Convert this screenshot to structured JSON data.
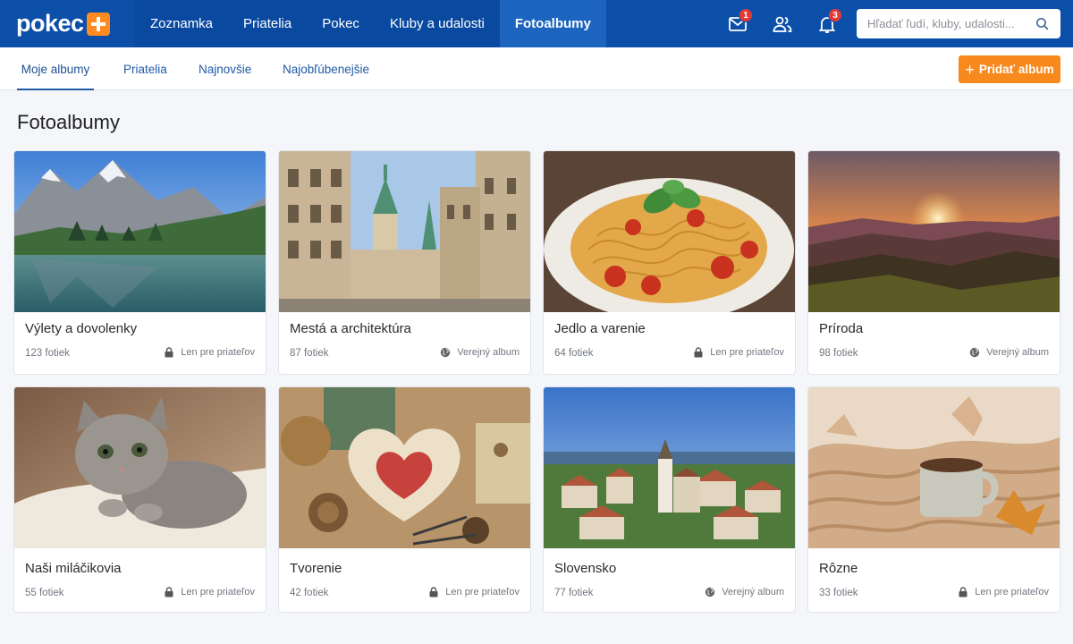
{
  "logo": {
    "text": "pokec"
  },
  "nav": {
    "items": [
      "Zoznamka",
      "Priatelia",
      "Pokec",
      "Kluby a udalosti",
      "Fotoalbumy"
    ],
    "active": "Fotoalbumy"
  },
  "top_icons": {
    "messages": {
      "icon": "mail-icon",
      "badge": "1"
    },
    "friends": {
      "icon": "people-icon"
    },
    "notifications": {
      "icon": "bell-icon",
      "badge": "3"
    }
  },
  "search": {
    "placeholder": "Hľadať ľudí, kluby, udalosti...",
    "value": ""
  },
  "subnav": {
    "tabs": [
      "Moje albumy",
      "Priatelia",
      "Najnovšie",
      "Najobľúbenejšie"
    ],
    "active": "Moje albumy"
  },
  "add_album": {
    "label": "Pridať album"
  },
  "page": {
    "title": "Fotoalbumy"
  },
  "albums": [
    {
      "title": "Výlety a dovolenky",
      "count": "123 fotiek",
      "privacy": "Len pre priateľov",
      "privacy_icon": "lock-icon",
      "image": "mountain-lake"
    },
    {
      "title": "Mestá a architektúra",
      "count": "87 fotiek",
      "privacy": "Verejný album",
      "privacy_icon": "globe-icon",
      "image": "city-street"
    },
    {
      "title": "Jedlo a varenie",
      "count": "64 fotiek",
      "privacy": "Len pre priateľov",
      "privacy_icon": "lock-icon",
      "image": "pasta-plate"
    },
    {
      "title": "Príroda",
      "count": "98 fotiek",
      "privacy": "Verejný album",
      "privacy_icon": "globe-icon",
      "image": "sunset-hills"
    },
    {
      "title": "Naši miláčikovia",
      "count": "55 fotiek",
      "privacy": "Len pre priateľov",
      "privacy_icon": "lock-icon",
      "image": "kitten"
    },
    {
      "title": "Tvorenie",
      "count": "42 fotiek",
      "privacy": "Len pre priateľov",
      "privacy_icon": "lock-icon",
      "image": "crafts-heart"
    },
    {
      "title": "Slovensko",
      "count": "77 fotiek",
      "privacy": "Verejný album",
      "privacy_icon": "globe-icon",
      "image": "slovak-town"
    },
    {
      "title": "Rôzne",
      "count": "33 fotiek",
      "privacy": "Len pre priateľov",
      "privacy_icon": "lock-icon",
      "image": "coffee-blanket"
    }
  ],
  "colors": {
    "brand_blue": "#0c4fa8",
    "accent_orange": "#f7891d",
    "badge_red": "#e53935",
    "link_blue": "#1f5aa6"
  }
}
